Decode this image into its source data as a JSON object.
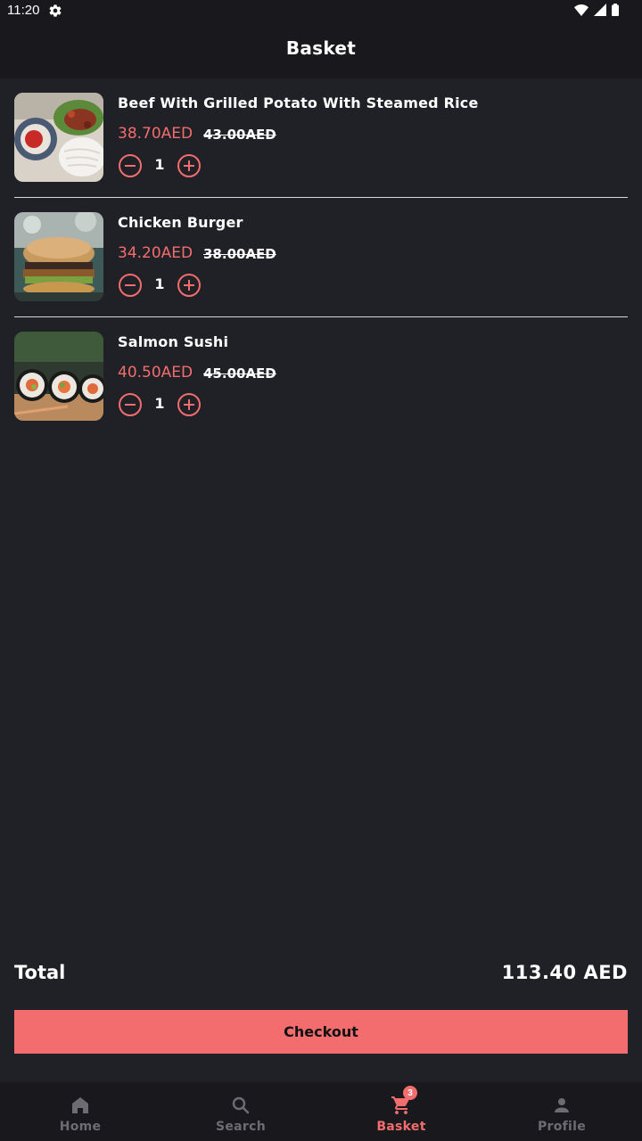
{
  "status_bar": {
    "time": "11:20"
  },
  "header": {
    "title": "Basket"
  },
  "items": [
    {
      "name": "Beef With Grilled Potato With Steamed Rice",
      "price": "38.70AED",
      "old_price": "43.00AED",
      "quantity": "1",
      "image": "beef-rice-plate"
    },
    {
      "name": "Chicken Burger",
      "price": "34.20AED",
      "old_price": "38.00AED",
      "quantity": "1",
      "image": "chicken-burger"
    },
    {
      "name": "Salmon Sushi",
      "price": "40.50AED",
      "old_price": "45.00AED",
      "quantity": "1",
      "image": "salmon-sushi"
    }
  ],
  "summary": {
    "total_label": "Total",
    "total_value": "113.40 AED",
    "checkout_label": "Checkout"
  },
  "nav": {
    "items": [
      {
        "label": "Home",
        "icon": "home-icon",
        "active": false
      },
      {
        "label": "Search",
        "icon": "search-icon",
        "active": false
      },
      {
        "label": "Basket",
        "icon": "cart-icon",
        "active": true,
        "badge": "3"
      },
      {
        "label": "Profile",
        "icon": "person-icon",
        "active": false
      }
    ]
  },
  "colors": {
    "background": "#202126",
    "bar": "#19191d",
    "accent": "#f26d6d",
    "inactive": "#6c6c72"
  }
}
